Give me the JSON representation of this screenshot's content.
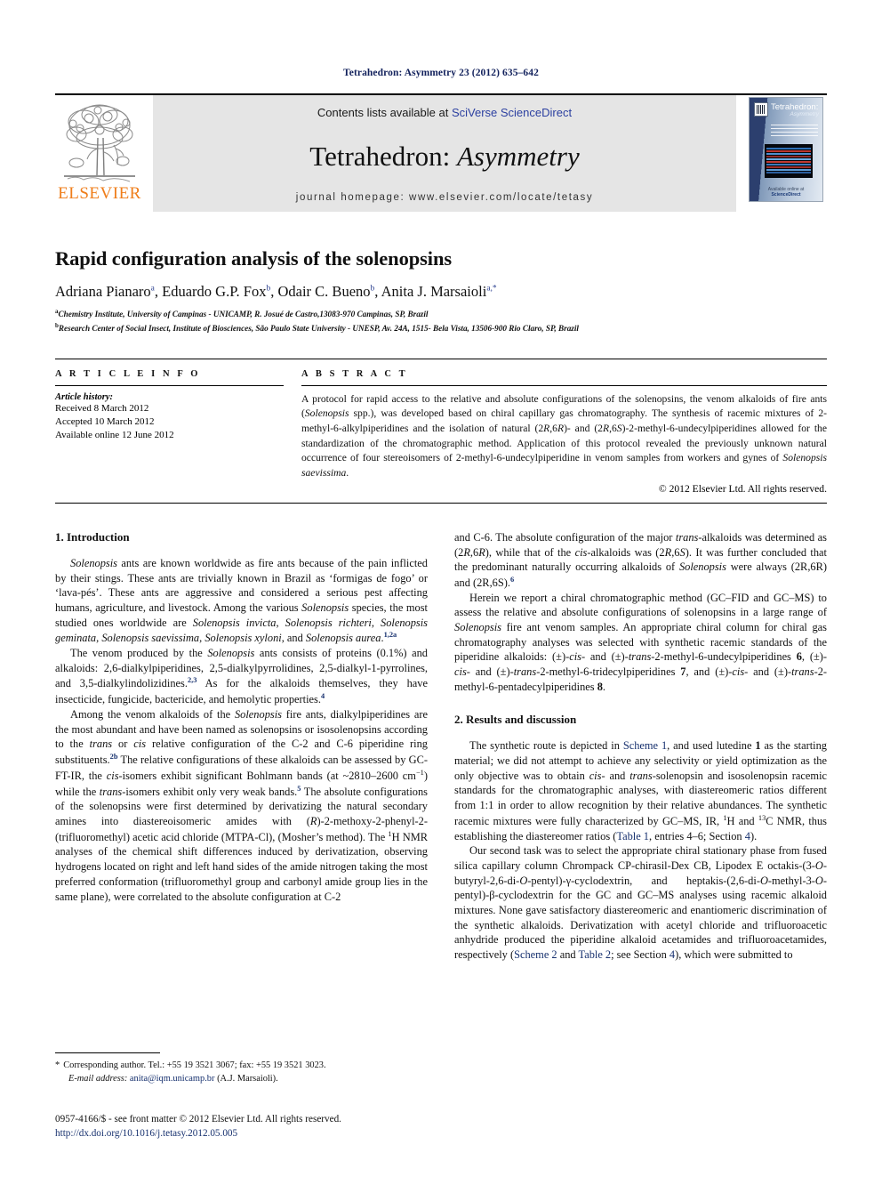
{
  "running_head": {
    "journal": "Tetrahedron:",
    "journal_italic": "Asymmetry",
    "citation": "23 (2012) 635–642",
    "full": "Tetrahedron: Asymmetry 23 (2012) 635–642",
    "color": "#12215c"
  },
  "masthead": {
    "publisher_logo_text": "ELSEVIER",
    "publisher_logo_color": "#ef7d1a",
    "contents_prefix": "Contents lists available at ",
    "contents_link": "SciVerse ScienceDirect",
    "contents_link_color": "#2b3fa0",
    "journal_title_roman": "Tetrahedron:",
    "journal_title_italic": "Asymmetry",
    "homepage": "journal homepage: www.elsevier.com/locate/tetasy",
    "banner_bg": "#e5e5e5",
    "cover": {
      "title": "Tetrahedron:",
      "subtitle": "Asymmetry",
      "footer_brand": "ScienceDirect",
      "footer_note": "Available online at"
    }
  },
  "title": "Rapid configuration analysis of the solenopsins",
  "authors": [
    {
      "name": "Adriana Pianaro",
      "marks": "a"
    },
    {
      "name": "Eduardo G.P. Fox",
      "marks": "b"
    },
    {
      "name": "Odair C. Bueno",
      "marks": "b"
    },
    {
      "name": "Anita J. Marsaioli",
      "marks": "a,*"
    }
  ],
  "affiliations": [
    {
      "mark": "a",
      "text": "Chemistry Institute, University of Campinas - UNICAMP, R. Josué de Castro,13083-970 Campinas, SP, Brazil"
    },
    {
      "mark": "b",
      "text": "Research Center of Social Insect, Institute of Biosciences, São Paulo State University - UNESP, Av. 24A, 1515- Bela Vista, 13506-900 Rio Claro, SP, Brazil"
    }
  ],
  "article_info": {
    "heading": "A R T I C L E    I N F O",
    "history_label": "Article history:",
    "history": [
      "Received 8 March 2012",
      "Accepted 10 March 2012",
      "Available online 12 June 2012"
    ]
  },
  "abstract": {
    "heading": "A B S T R A C T",
    "body_html": "A protocol for rapid access to the relative and absolute configurations of the solenopsins, the venom alkaloids of fire ants (<span class=\"it\">Solenopsis</span> spp.), was developed based on chiral capillary gas chromatography. The synthesis of racemic mixtures of 2-methyl-6-alkylpiperidines and the isolation of natural (2<span class=\"it\">R</span>,6<span class=\"it\">R</span>)- and (2<span class=\"it\">R</span>,6<span class=\"it\">S</span>)-2-methyl-6-undecylpiperidines allowed for the standardization of the chromatographic method. Application of this protocol revealed the previously unknown natural occurrence of four stereoisomers of 2-methyl-6-undecylpiperidine in venom samples from workers and gynes of <span class=\"it\">Solenopsis saevissima</span>.",
    "copyright": "© 2012 Elsevier Ltd. All rights reserved."
  },
  "sections": {
    "introduction_heading": "1. Introduction",
    "results_heading": "2. Results and discussion"
  },
  "paragraphs": {
    "intro_p1": "<span class=\"it\">Solenopsis</span> ants are known worldwide as fire ants because of the pain inflicted by their stings. These ants are trivially known in Brazil as ‘formigas de fogo’ or ‘lava-pés’. These ants are aggressive and considered a serious pest affecting humans, agriculture, and livestock. Among the various <span class=\"it\">Solenopsis</span> species, the most studied ones worldwide are <span class=\"it\">Solenopsis invicta</span>, <span class=\"it\">Solenopsis richteri</span>, <span class=\"it\">Solenopsis geminata</span>, <span class=\"it\">Solenopsis saevissima</span>, <span class=\"it\">Solenopsis xyloni</span>, and <span class=\"it\">Solenopsis aurea</span>.<sup>1,2a</sup>",
    "intro_p2": "The venom produced by the <span class=\"it\">Solenopsis</span> ants consists of proteins (0.1%) and alkaloids: 2,6-dialkylpiperidines, 2,5-dialkylpyrrolidines, 2,5-dialkyl-1-pyrrolines, and 3,5-dialkylindolizidines.<sup>2,3</sup> As for the alkaloids themselves, they have insecticide, fungicide, bactericide, and hemolytic properties.<sup>4</sup>",
    "intro_p3": "Among the venom alkaloids of the <span class=\"it\">Solenopsis</span> fire ants, dialkylpiperidines are the most abundant and have been named as solenopsins or isosolenopsins according to the <span class=\"it\">trans</span> or <span class=\"it\">cis</span> relative configuration of the C-2 and C-6 piperidine ring substituents.<sup>2b</sup> The relative configurations of these alkaloids can be assessed by GC-FT-IR, the <span class=\"it\">cis</span>-isomers exhibit significant Bohlmann bands (at ~2810–2600 cm<sup class=\"blk\">−1</sup>) while the <span class=\"it\">trans</span>-isomers exhibit only very weak bands.<sup>5</sup> The absolute configurations of the solenopsins were first determined by derivatizing the natural secondary amines into diastereoisomeric amides with (<span class=\"it\">R</span>)-2-methoxy-2-phenyl-2-(trifluoromethyl) acetic acid chloride (MTPA-Cl), (Mosher’s method). The <sup class=\"blk\">1</sup>H NMR analyses of the chemical shift differences induced by derivatization, observing hydrogens located on right and left hand sides of the amide nitrogen taking the most preferred conformation (trifluoromethyl group and carbonyl amide group lies in the same plane), were correlated to the absolute configuration at C-2",
    "right_p1": "and C-6. The absolute configuration of the major <span class=\"it\">trans</span>-alkaloids was determined as (2<span class=\"it\">R</span>,6<span class=\"it\">R</span>), while that of the <span class=\"it\">cis</span>-alkaloids was (2<span class=\"it\">R</span>,6<span class=\"it\">S</span>). It was further concluded that the predominant naturally occurring alkaloids of <span class=\"it\">Solenopsis</span> were always (2R,6R) and (2R,6S).<sup>6</sup>",
    "right_p2": "Herein we report a chiral chromatographic method (GC–FID and GC–MS) to assess the relative and absolute configurations of solenopsins in a large range of <span class=\"it\">Solenopsis</span> fire ant venom samples. An appropriate chiral column for chiral gas chromatography analyses was selected with synthetic racemic standards of the piperidine alkaloids: (±)-<span class=\"it\">cis</span>- and (±)-<span class=\"it\">trans</span>-2-methyl-6-undecylpiperidines <span class=\"bf\">6</span>, (±)-<span class=\"it\">cis</span>- and (±)-<span class=\"it\">trans</span>-2-methyl-6-tridecylpiperidines <span class=\"bf\">7</span>, and (±)-<span class=\"it\">cis</span>- and (±)-<span class=\"it\">trans</span>-2-methyl-6-pentadecylpiperidines <span class=\"bf\">8</span>.",
    "right_p3": "The synthetic route is depicted in <span class=\"lnk\">Scheme 1</span>, and used lutedine <span class=\"bf\">1</span> as the starting material; we did not attempt to achieve any selectivity or yield optimization as the only objective was to obtain <span class=\"it\">cis</span>- and <span class=\"it\">trans</span>-solenopsin and isosolenopsin racemic standards for the chromatographic analyses, with diastereomeric ratios different from 1:1 in order to allow recognition by their relative abundances. The synthetic racemic mixtures were fully characterized by GC–MS, IR, <sup class=\"blk\">1</sup>H and <sup class=\"blk\">13</sup>C NMR, thus establishing the diastereomer ratios (<span class=\"lnk\">Table 1</span>, entries 4–6; Section <span class=\"lnk\">4</span>).",
    "right_p4": "Our second task was to select the appropriate chiral stationary phase from fused silica capillary column Chrompack CP-chirasil-Dex CB, Lipodex E octakis-(3-<span class=\"it\">O</span>-butyryl-2,6-di-<span class=\"it\">O</span>-pentyl)-γ-cyclodextrin, and heptakis-(2,6-di-<span class=\"it\">O</span>-methyl-3-<span class=\"it\">O</span>-pentyl)-β-cyclodextrin for the GC and GC–MS analyses using racemic alkaloid mixtures. None gave satisfactory diastereomeric and enantiomeric discrimination of the synthetic alkaloids. Derivatization with acetyl chloride and trifluoroacetic anhydride produced the piperidine alkaloid acetamides and trifluoroacetamides, respectively (<span class=\"lnk\">Scheme 2</span> and <span class=\"lnk\">Table 2</span>; see Section <span class=\"lnk\">4</span>), which were submitted to"
  },
  "footnote": {
    "corresponding": "Corresponding author. Tel.: +55 19 3521 3067; fax: +55 19 3521 3023.",
    "email_label": "E-mail address:",
    "email": "anita@iqm.unicamp.br",
    "email_owner": "(A.J. Marsaioli)."
  },
  "issn_block": {
    "line1": "0957-4166/$ - see front matter © 2012 Elsevier Ltd. All rights reserved.",
    "doi": "http://dx.doi.org/10.1016/j.tetasy.2012.05.005"
  }
}
